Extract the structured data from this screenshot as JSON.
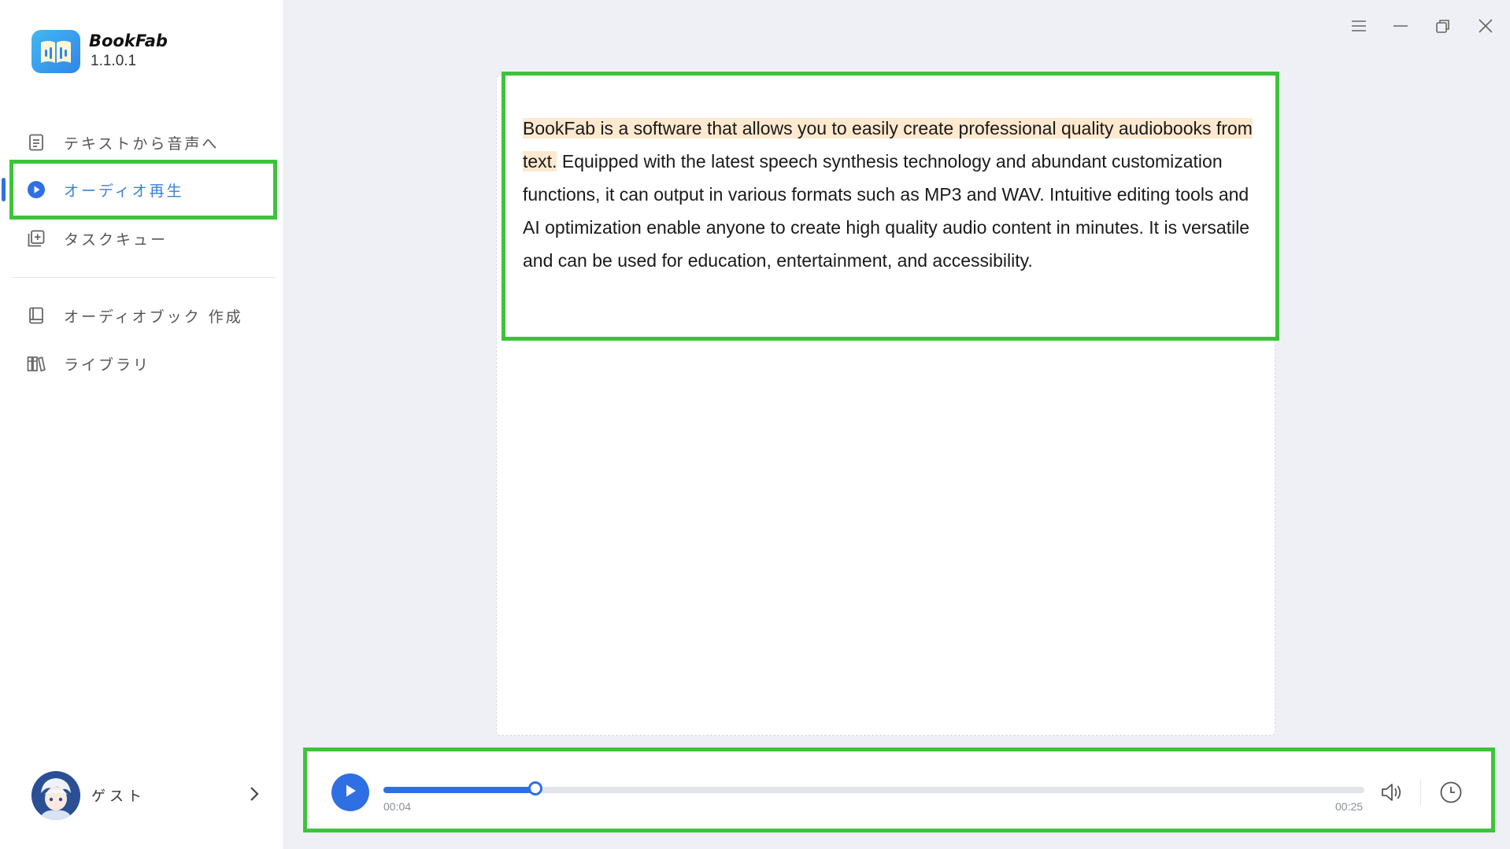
{
  "app": {
    "name": "BookFab",
    "version": "1.1.0.1"
  },
  "sidebar": {
    "items": [
      {
        "label": "テキストから音声へ",
        "icon": "document-icon"
      },
      {
        "label": "オーディオ再生",
        "icon": "play-circle-icon",
        "active": true
      },
      {
        "label": "タスクキュー",
        "icon": "task-queue-icon"
      },
      {
        "label": "オーディオブック 作成",
        "icon": "book-icon"
      },
      {
        "label": "ライブラリ",
        "icon": "library-icon"
      }
    ],
    "user": {
      "name": "ゲスト"
    }
  },
  "content": {
    "highlighted_text": "BookFab is a software that allows you to easily create professional quality audiobooks from text.",
    "remaining_text": " Equipped with the latest speech synthesis technology and abundant customization functions, it can output in various formats such as MP3 and WAV. Intuitive editing tools and AI optimization enable anyone to create high quality audio content in minutes. It is versatile and can be used for education, entertainment, and accessibility."
  },
  "player": {
    "current_time": "00:04",
    "total_time": "00:25",
    "progress": 0.155
  },
  "colors": {
    "accent": "#2f6fe4",
    "highlight": "#fde9cf",
    "annotation_green": "#3dc33b"
  }
}
